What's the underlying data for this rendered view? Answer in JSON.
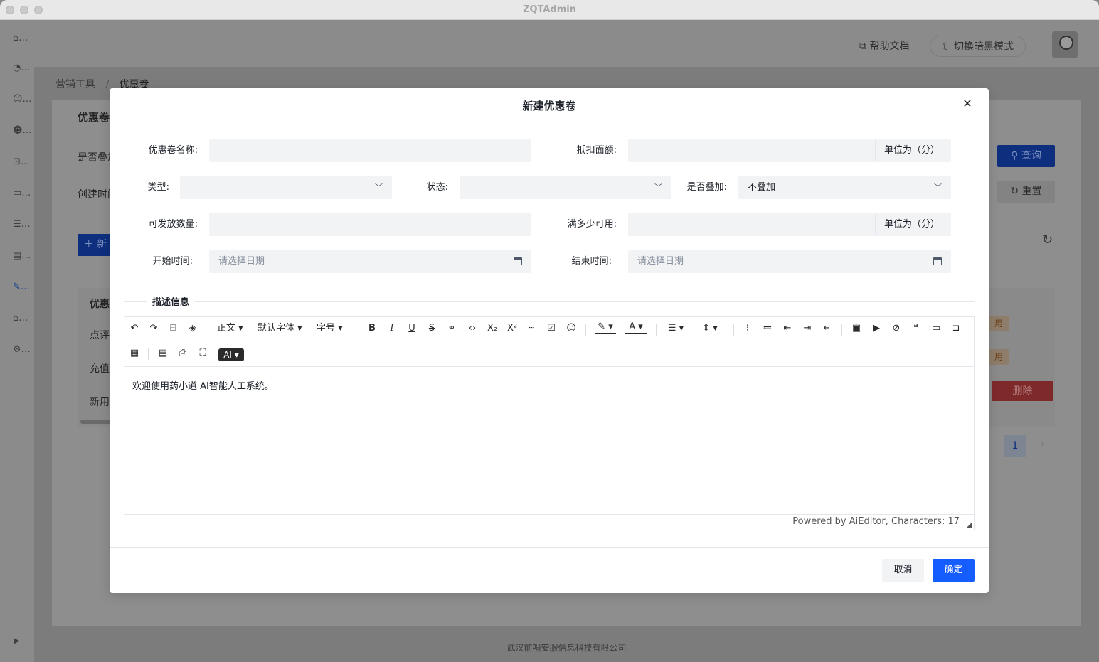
{
  "window": {
    "title": "ZQTAdmin"
  },
  "colors": {
    "primary": "#165dff",
    "danger": "#f53f3f",
    "field_bg": "#f2f3f5"
  },
  "sidebar": {
    "icons": [
      "home-icon",
      "dashboard-icon",
      "user-add-icon",
      "users-icon",
      "bookmark-icon",
      "folder-add-icon",
      "list-icon",
      "form-icon",
      "tool-icon",
      "shop-icon",
      "settings-icon"
    ]
  },
  "header": {
    "help_label": "帮助文档",
    "theme_label": "切换暗黑模式"
  },
  "breadcrumb": {
    "parent": "营销工具",
    "separator": "/",
    "current": "优惠卷"
  },
  "background": {
    "card_title": "优惠卷",
    "filter_1": "是否叠加",
    "filter_2": "创建时间",
    "search_label": "查询",
    "reset_label": "重置",
    "new_label": "新",
    "col_1": "优惠",
    "row_1": "点评",
    "row_2": "充值",
    "row_3": "新用",
    "tag_1": "用",
    "tag_2": "用",
    "delete_label": "删除",
    "page": "1",
    "footer": "武汉前哨安服信息科技有限公司"
  },
  "modal": {
    "title": "新建优惠卷",
    "fields": {
      "name_label": "优惠卷名称:",
      "name_value": "",
      "deduct_label": "抵扣面额:",
      "deduct_value": "",
      "deduct_suffix": "单位为（分）",
      "type_label": "类型:",
      "type_value": "",
      "status_label": "状态:",
      "status_value": "",
      "stack_label": "是否叠加:",
      "stack_value": "不叠加",
      "quantity_label": "可发放数量:",
      "quantity_value": "",
      "min_label": "满多少可用:",
      "min_value": "",
      "min_suffix": "单位为（分）",
      "start_label": "开始时间:",
      "start_placeholder": "请选择日期",
      "end_label": "结束时间:",
      "end_placeholder": "请选择日期"
    },
    "section_title": "描述信息",
    "editor": {
      "heading_label": "正文",
      "font_label": "默认字体",
      "size_label": "字号",
      "ai_label": "AI",
      "content": "欢迎使用药小道 AI智能人工系统。",
      "footer": "Powered by AiEditor, Characters: 17"
    },
    "cancel_label": "取消",
    "ok_label": "确定"
  }
}
